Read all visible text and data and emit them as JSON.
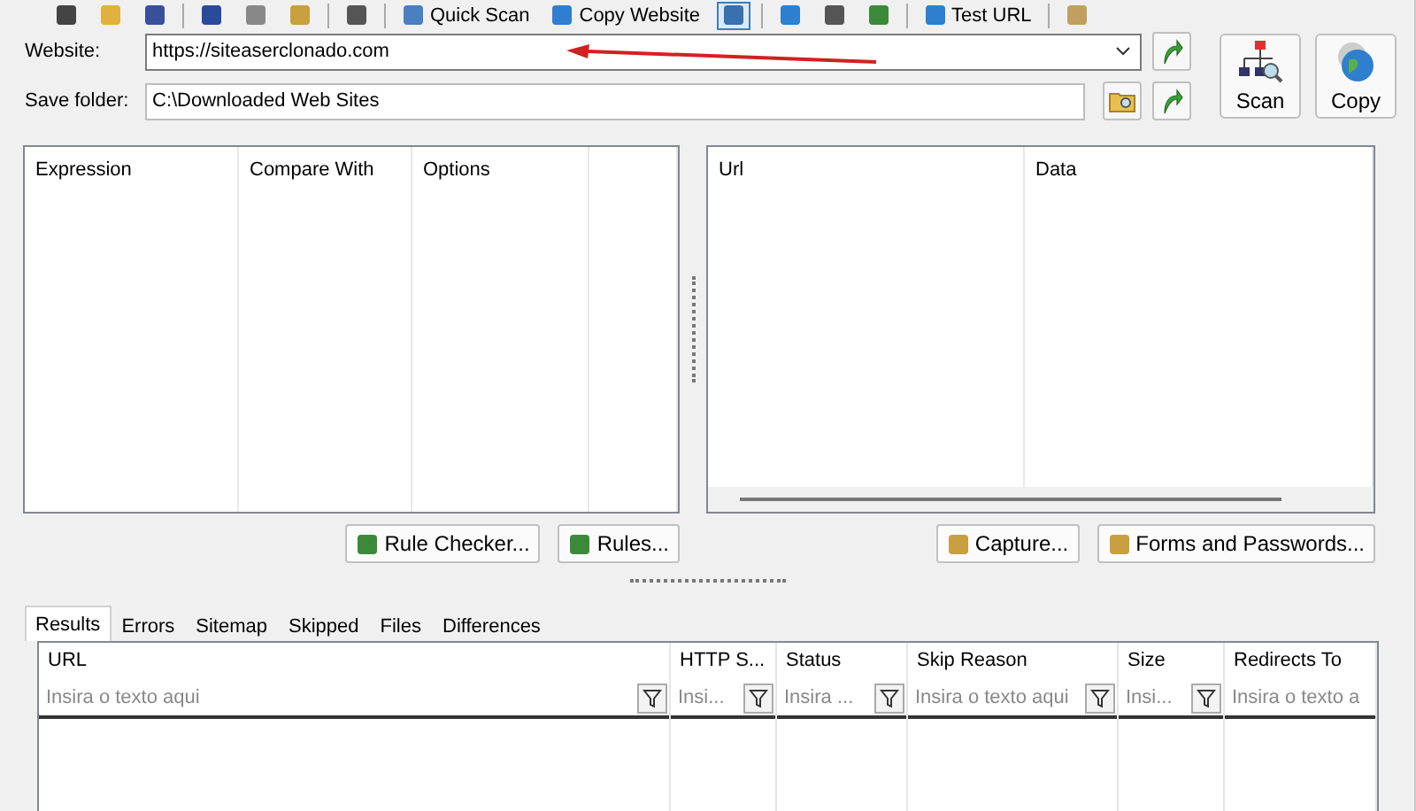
{
  "toolbar": {
    "items": [
      {
        "kind": "icon"
      },
      {
        "kind": "icon"
      },
      {
        "kind": "icon"
      },
      {
        "kind": "sep"
      },
      {
        "kind": "icon"
      },
      {
        "kind": "icon"
      },
      {
        "kind": "icon"
      },
      {
        "kind": "sep"
      },
      {
        "kind": "icon"
      },
      {
        "kind": "sep"
      },
      {
        "kind": "text",
        "label": "Quick Scan"
      },
      {
        "kind": "text",
        "label": "Copy Website"
      },
      {
        "kind": "icon",
        "selected": true
      },
      {
        "kind": "sep"
      },
      {
        "kind": "icon"
      },
      {
        "kind": "icon"
      },
      {
        "kind": "icon"
      },
      {
        "kind": "sep"
      },
      {
        "kind": "text",
        "label": "Test URL"
      },
      {
        "kind": "sep"
      },
      {
        "kind": "icon"
      }
    ]
  },
  "website": {
    "label": "Website:",
    "value": "https://siteaserclonado.com"
  },
  "save_folder": {
    "label": "Save folder:",
    "value": "C:\\Downloaded Web Sites"
  },
  "actions": [
    {
      "label": "Scan",
      "kind": "scan"
    },
    {
      "label": "Copy",
      "kind": "copy"
    }
  ],
  "rules_table": {
    "columns": [
      "Expression",
      "Compare With",
      "Options"
    ]
  },
  "capture_table": {
    "columns": [
      "Url",
      "Data"
    ]
  },
  "left_buttons": [
    "Rule Checker...",
    "Rules..."
  ],
  "right_buttons": [
    "Capture...",
    "Forms and Passwords..."
  ],
  "tabs": [
    {
      "label": "Results",
      "selected": true
    },
    {
      "label": "Errors",
      "selected": false
    },
    {
      "label": "Sitemap",
      "selected": false
    },
    {
      "label": "Skipped",
      "selected": false
    },
    {
      "label": "Files",
      "selected": false
    },
    {
      "label": "Differences",
      "selected": false
    }
  ],
  "results": {
    "columns": [
      {
        "title": "URL",
        "placeholder": "Insira o texto aqui"
      },
      {
        "title": "HTTP S...",
        "placeholder": "Insi..."
      },
      {
        "title": "Status",
        "placeholder": "Insira ..."
      },
      {
        "title": "Skip Reason",
        "placeholder": "Insira o texto aqui"
      },
      {
        "title": "Size",
        "placeholder": "Insi..."
      },
      {
        "title": "Redirects To",
        "placeholder": "Insira o texto a"
      }
    ]
  }
}
